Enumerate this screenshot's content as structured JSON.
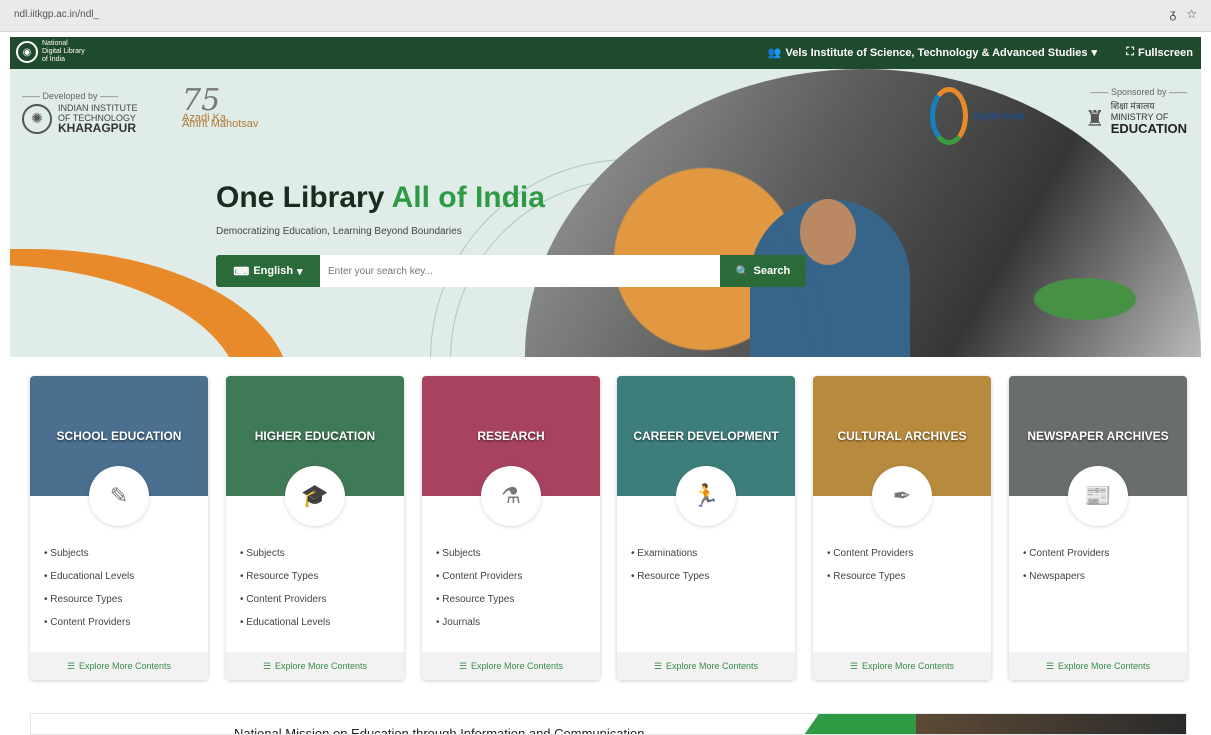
{
  "browser": {
    "url": "ndl.iitkgp.ac.in/ndl_",
    "icons": [
      "translate-icon",
      "star-icon"
    ]
  },
  "topnav": {
    "logo_line1": "National",
    "logo_line2": "Digital Library",
    "logo_line3": "of India",
    "institute": "Vels Institute of Science, Technology & Advanced Studies",
    "fullscreen": "Fullscreen"
  },
  "hero": {
    "developed_by": "Developed by",
    "iit_line1": "INDIAN INSTITUTE",
    "iit_line2": "OF TECHNOLOGY",
    "iit_line3": "KHARAGPUR",
    "azadi_75": "75",
    "azadi_line1": "Azadi Ka",
    "azadi_line2": "Amrit Mahotsav",
    "digital_india": "Digital India",
    "sponsored_by": "Sponsored by",
    "moe_hindi": "शिक्षा मंत्रालय",
    "moe_line1": "MINISTRY OF",
    "moe_line2": "EDUCATION",
    "headline_a": "One Library",
    "headline_b": "All of India",
    "tagline": "Democratizing Education, Learning Beyond Boundaries",
    "language": "English",
    "search_placeholder": "Enter your search key...",
    "search_button": "Search"
  },
  "cards": [
    {
      "title": "SCHOOL EDUCATION",
      "color": "#4a6f8f",
      "items": [
        "Subjects",
        "Educational Levels",
        "Resource Types",
        "Content Providers"
      ],
      "explore": "Explore More Contents"
    },
    {
      "title": "HIGHER EDUCATION",
      "color": "#3f7a56",
      "items": [
        "Subjects",
        "Resource Types",
        "Content Providers",
        "Educational Levels"
      ],
      "explore": "Explore More Contents"
    },
    {
      "title": "RESEARCH",
      "color": "#a8435f",
      "items": [
        "Subjects",
        "Content Providers",
        "Resource Types",
        "Journals"
      ],
      "explore": "Explore More Contents"
    },
    {
      "title": "CAREER DEVELOPMENT",
      "color": "#3d7e7a",
      "items": [
        "Examinations",
        "Resource Types"
      ],
      "explore": "Explore More Contents"
    },
    {
      "title": "CULTURAL ARCHIVES",
      "color": "#b88a3e",
      "items": [
        "Content Providers",
        "Resource Types"
      ],
      "explore": "Explore More Contents"
    },
    {
      "title": "NEWSPAPER ARCHIVES",
      "color": "#6a6d6e",
      "items": [
        "Content Providers",
        "Newspapers"
      ],
      "explore": "Explore More Contents"
    }
  ],
  "banner": {
    "text": "National Mission on Education through Information and Communication"
  }
}
